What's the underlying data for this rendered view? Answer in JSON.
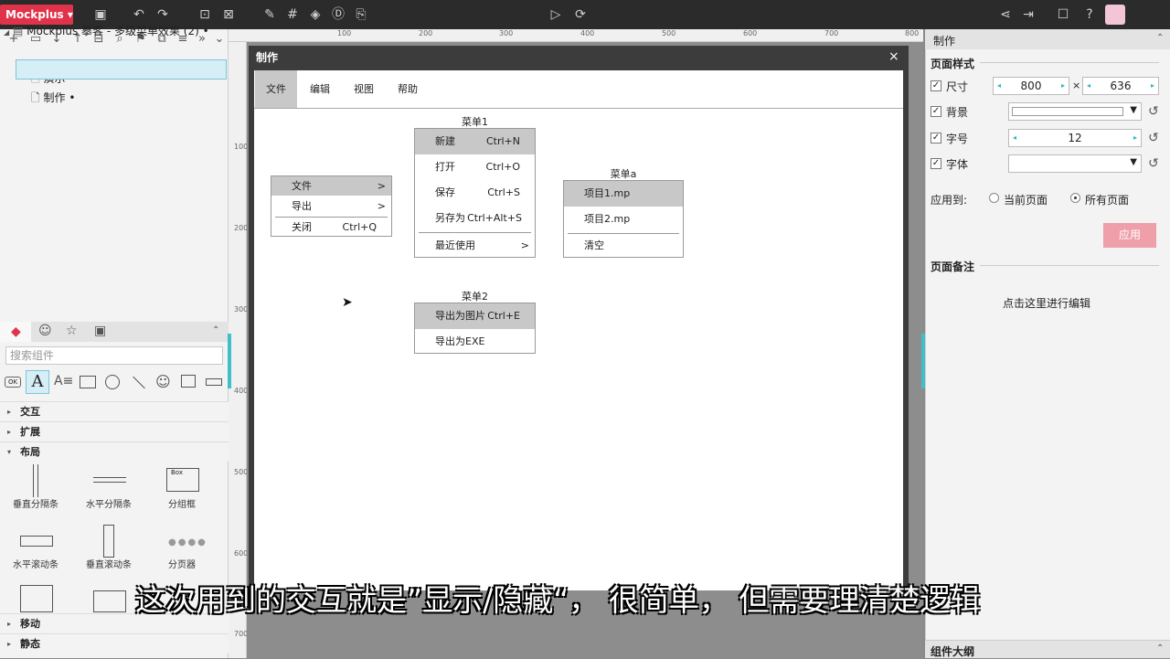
{
  "app": {
    "brand": "Mockplus ▾",
    "toolbar_icons": [
      "save-icon",
      "undo-icon",
      "redo-icon",
      "align-icon",
      "distribute-icon",
      "brush-icon",
      "grid-icon",
      "fill-icon",
      "d-icon",
      "export-icon",
      "play-icon",
      "sync-icon",
      "share-icon",
      "logout-icon",
      "window-icon",
      "help-icon",
      "avatar"
    ]
  },
  "left_panel": {
    "project": "Mockplus 摹客 - 多级菜单效果 (2)",
    "project_mark": "•",
    "pages": [
      {
        "label": "演示",
        "mark": "•"
      },
      {
        "label": "制作",
        "mark": "•"
      }
    ],
    "search_placeholder": "搜索组件",
    "categories": {
      "interact": "交互",
      "extend": "扩展",
      "layout": "布局",
      "move": "移动",
      "static": "静态"
    },
    "layout_items": [
      "垂直分隔条",
      "水平分隔条",
      "分组框",
      "水平滚动条",
      "垂直滚动条",
      "分页器"
    ]
  },
  "ruler": {
    "top": [
      "100",
      "200",
      "300",
      "400",
      "500",
      "600",
      "700",
      "800"
    ],
    "left": [
      "100",
      "200",
      "300",
      "400",
      "500",
      "600",
      "700"
    ]
  },
  "canvas": {
    "frame_title": "制作",
    "close": "×",
    "menubar": [
      "文件",
      "编辑",
      "视图",
      "帮助"
    ],
    "context_menu": [
      {
        "label": "文件",
        "arrow": ">"
      },
      {
        "label": "导出",
        "arrow": ">"
      },
      {
        "label": "关闭",
        "shortcut": "Ctrl+Q"
      }
    ],
    "menu1": {
      "title": "菜单1",
      "items": [
        {
          "label": "新建",
          "shortcut": "Ctrl+N"
        },
        {
          "label": "打开",
          "shortcut": "Ctrl+O"
        },
        {
          "label": "保存",
          "shortcut": "Ctrl+S"
        },
        {
          "label": "另存为",
          "shortcut": "Ctrl+Alt+S"
        },
        {
          "label": "最近使用",
          "shortcut": ">"
        }
      ]
    },
    "menua": {
      "title": "菜单a",
      "items": [
        "项目1.mp",
        "项目2.mp",
        "清空"
      ]
    },
    "menu2": {
      "title": "菜单2",
      "items": [
        {
          "label": "导出为图片",
          "shortcut": "Ctrl+E"
        },
        {
          "label": "导出为EXE",
          "shortcut": ""
        }
      ]
    }
  },
  "right_panel": {
    "title": "制作",
    "page_style": "页面样式",
    "size_label": "尺寸",
    "width": "800",
    "times": "×",
    "height": "636",
    "bg_label": "背景",
    "fontsize_label": "字号",
    "fontsize": "12",
    "font_label": "字体",
    "apply_to": "应用到:",
    "current_page": "当前页面",
    "all_pages": "所有页面",
    "apply_button": "应用",
    "notes_title": "页面备注",
    "notes_hint": "点击这里进行编辑",
    "outline": "组件大纲"
  },
  "subtitle": "这次用到的交互就是”显示/隐藏“， 很简单， 但需要理清楚逻辑"
}
